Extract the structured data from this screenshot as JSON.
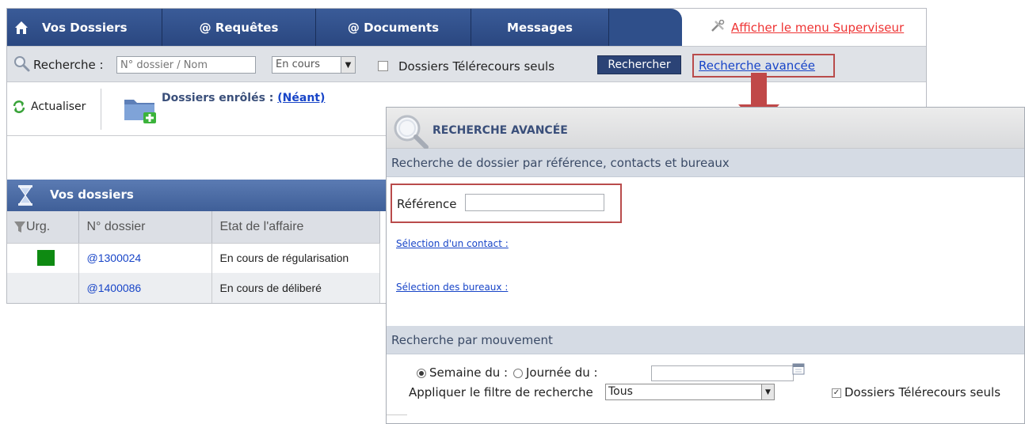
{
  "tabs": [
    {
      "label": "Vos Dossiers"
    },
    {
      "label": "@ Requêtes"
    },
    {
      "label": "@ Documents"
    },
    {
      "label": "Messages"
    }
  ],
  "supervisor_link": "Afficher le menu Superviseur",
  "search": {
    "label": "Recherche :",
    "placeholder": "N° dossier / Nom",
    "status_value": "En cours",
    "telerecours_label": "Dossiers Télérecours seuls",
    "button_label": "Rechercher",
    "advanced_link": "Recherche avancée"
  },
  "toolbar": {
    "refresh_label": "Actualiser",
    "enrolled_label": "Dossiers enrôlés :",
    "enrolled_link": "(Néant)"
  },
  "dossiers": {
    "title": "Vos dossiers",
    "columns": [
      "Urg.",
      "N° dossier",
      "Etat de l'affaire"
    ],
    "rows": [
      {
        "urgent": true,
        "numero": "@1300024",
        "etat": "En cours de régularisation"
      },
      {
        "urgent": false,
        "numero": "@1400086",
        "etat": "En cours de déliberé"
      }
    ],
    "urgent_color": "#0e8a12"
  },
  "advanced_search": {
    "title": "RECHERCHE AVANCÉE",
    "section1_title": "Recherche de dossier par référence, contacts et bureaux",
    "reference_label": "Référence",
    "contact_link": "Sélection d'un contact :",
    "bureaux_link": "Sélection des bureaux :",
    "section2_title": "Recherche par mouvement",
    "week_label": "Semaine du :",
    "day_label": "Journée du :",
    "filter_label": "Appliquer le filtre de recherche",
    "filter_value": "Tous",
    "telerecours_label": "Dossiers Télérecours seuls",
    "telerecours_checked": true,
    "week_selected": true
  },
  "colors": {
    "tab_bg": "#2f4f8a",
    "highlight": "#b94b4b",
    "link": "#1845c8",
    "panel_header": "#4a6aa5"
  }
}
